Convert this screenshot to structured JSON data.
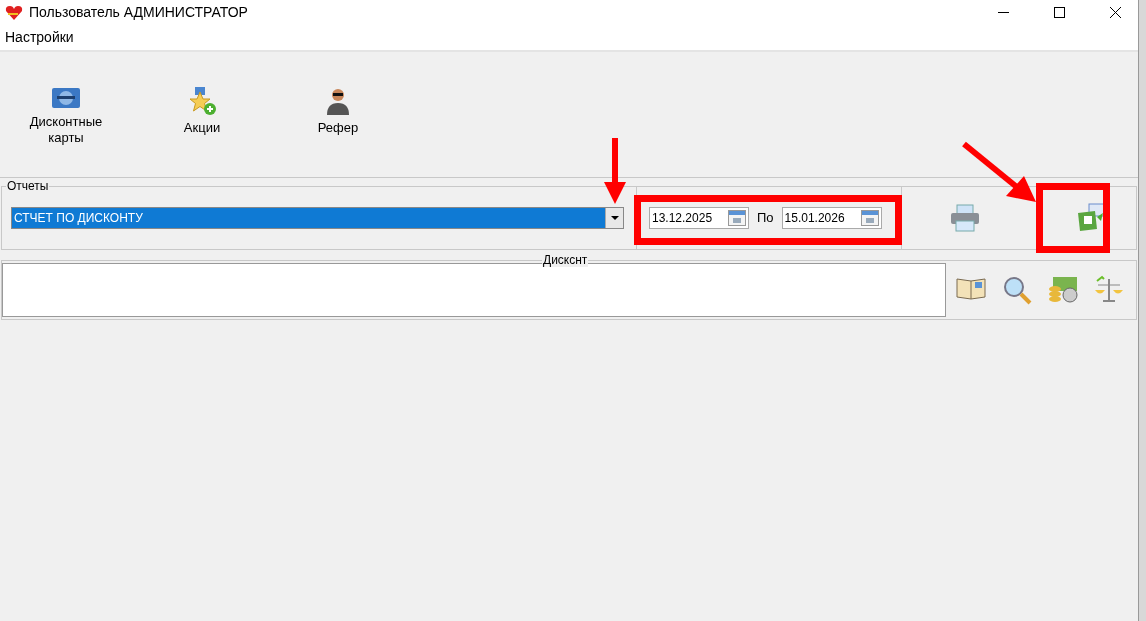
{
  "window": {
    "title": "Пользователь АДМИНИСТРАТОР"
  },
  "menu": [
    "Настройки"
  ],
  "toolbar": [
    {
      "kind": "card",
      "label": "Дисконтные карты"
    },
    {
      "kind": "star",
      "label": "Акции"
    },
    {
      "kind": "person",
      "label": "Рефер"
    }
  ],
  "reports": {
    "title": "Отчеты",
    "report": "СТЧЕТ ПО ДИСКОНТУ",
    "date_from": "13.12.2025",
    "to_label": "По",
    "date_to": "15.01.2026"
  },
  "discount": {
    "title": "Дискснт"
  }
}
